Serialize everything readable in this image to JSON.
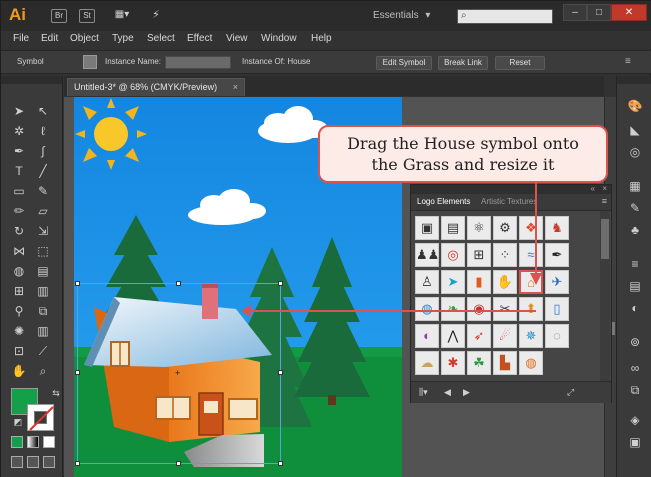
{
  "app": {
    "logo": "Ai",
    "bridge_label": "Br",
    "stock_label": "St",
    "workspace_label": "Essentials",
    "workspace_caret": "▾",
    "window_controls": [
      "minimize",
      "maximize",
      "close"
    ]
  },
  "menubar": {
    "items": [
      "File",
      "Edit",
      "Object",
      "Type",
      "Select",
      "Effect",
      "View",
      "Window",
      "Help"
    ]
  },
  "controlbar": {
    "selection_label": "Symbol",
    "instance_name_label": "Instance Name:",
    "instance_name_value": "",
    "instance_of_label": "Instance Of: House",
    "edit_symbol": "Edit Symbol",
    "break_link": "Break Link",
    "reset": "Reset"
  },
  "document": {
    "tab_title": "Untitled-3* @ 68% (CMYK/Preview)",
    "close_glyph": "×"
  },
  "symbols_panel": {
    "tabs": [
      "Logo Elements",
      "Artistic Textures"
    ],
    "active_tab": "Logo Elements",
    "menu_glyph": "≡",
    "selected_symbol": "House",
    "icons": [
      "frame-icon",
      "presentation-icon",
      "atom-icon",
      "gear-icon",
      "fish-logo-icon",
      "chess-icon",
      "",
      "people-icon",
      "target-icon",
      "grid-icon",
      "dots-icon",
      "pool-icon",
      "pen-icon",
      "",
      "person-icon",
      "fish-icon",
      "hydrant-icon",
      "hand-icon",
      "house-icon",
      "jet-icon",
      "",
      "globe-icon",
      "leaf-icon",
      "rings-icon",
      "scissors-icon",
      "arrow-sign-icon",
      "bookmark-icon",
      "",
      "planet-icon",
      "road-icon",
      "rocket-icon",
      "runner-icon",
      "star-emblem-icon",
      "swirl-icon",
      "",
      "chat-icon",
      "lamp-icon",
      "palm-icon",
      "skyline-icon",
      "ball-icon",
      "",
      ""
    ]
  },
  "callout": {
    "line1": "Drag the House symbol onto",
    "line2": "the Grass and resize it"
  },
  "colors": {
    "fill": "#14a04a",
    "stroke": "none",
    "callout_border": "#d9534f",
    "sky": "#1d92e8",
    "grass": "#0f8f3c"
  },
  "tools": [
    "selection-tool",
    "direct-selection-tool",
    "magic-wand-tool",
    "lasso-tool",
    "pen-tool",
    "curvature-tool",
    "type-tool",
    "line-tool",
    "rectangle-tool",
    "paintbrush-tool",
    "pencil-tool",
    "eraser-tool",
    "rotate-tool",
    "scale-tool",
    "width-tool",
    "free-transform-tool",
    "shape-builder-tool",
    "perspective-tool",
    "mesh-tool",
    "gradient-tool",
    "eyedropper-tool",
    "blend-tool",
    "symbol-sprayer-tool",
    "graph-tool",
    "artboard-tool",
    "slice-tool",
    "hand-tool",
    "zoom-tool"
  ],
  "dock": [
    "color-icon",
    "color-guide-icon",
    "appearance-icon",
    "swatches-icon",
    "brushes-icon",
    "symbols-icon",
    "stroke-icon",
    "gradient-icon",
    "transparency-icon",
    "graphic-styles-icon",
    "links-icon",
    "layers-icon",
    "artboards-icon"
  ]
}
